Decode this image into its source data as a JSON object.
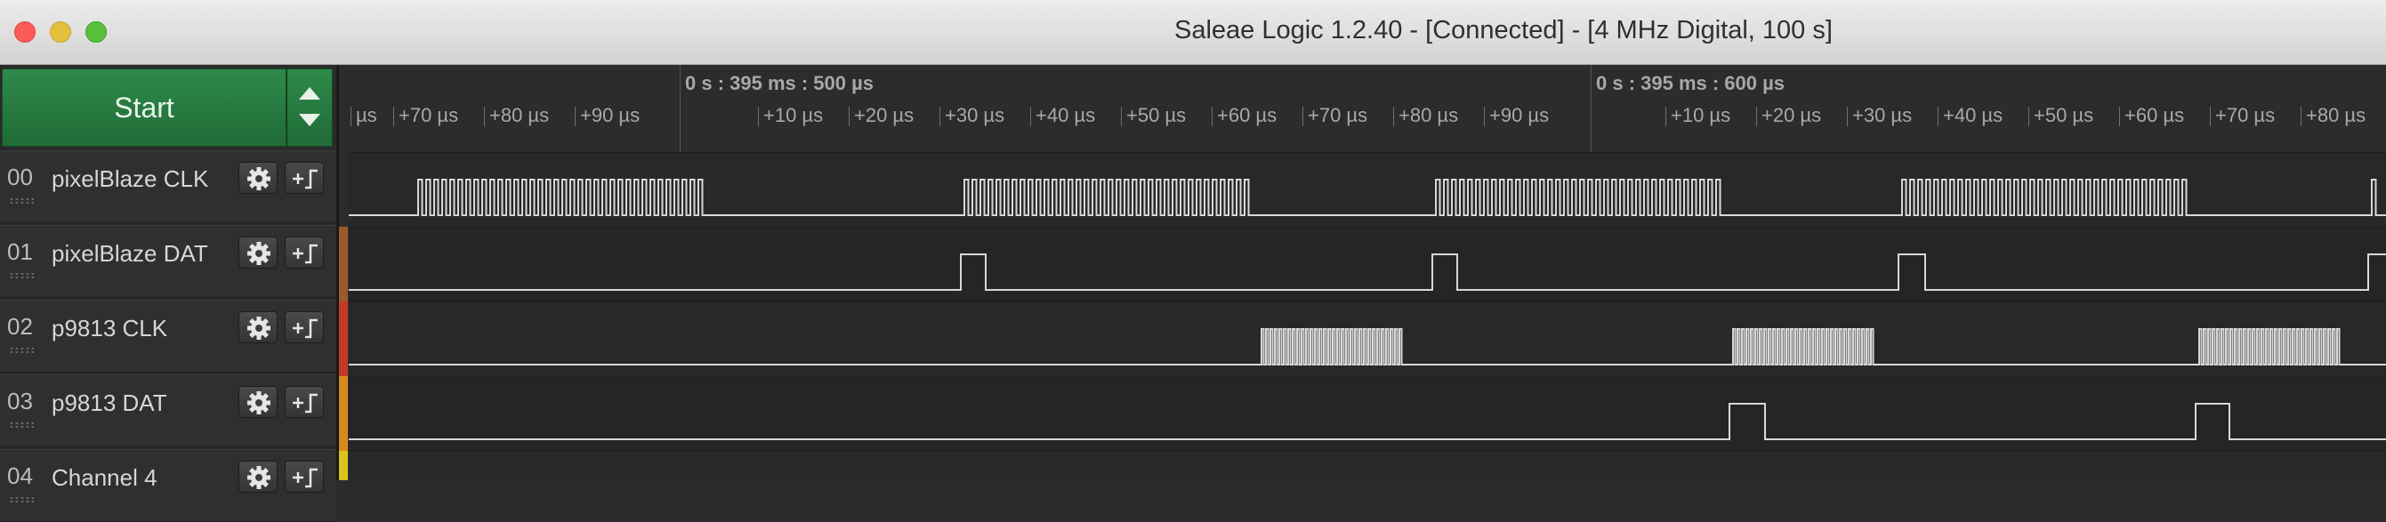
{
  "window": {
    "title": "Saleae Logic 1.2.40 - [Connected] - [4 MHz Digital, 100 s]"
  },
  "toolbar": {
    "start_label": "Start",
    "menu_icons": [
      "triangle-up-icon",
      "triangle-down-icon"
    ]
  },
  "timeline": {
    "major_labels": [
      "0 s : 395 ms : 500 µs",
      "0 s : 395 ms : 600 µs"
    ],
    "tick_labels": [
      "µs",
      "+70 µs",
      "+80 µs",
      "+90 µs",
      "+10 µs",
      "+20 µs",
      "+30 µs",
      "+40 µs",
      "+50 µs",
      "+60 µs",
      "+70 µs",
      "+80 µs",
      "+90 µs",
      "+10 µs",
      "+20 µs",
      "+30 µs",
      "+40 µs",
      "+50 µs",
      "+60 µs",
      "+70 µs",
      "+80 µs"
    ]
  },
  "channels": [
    {
      "num": "00",
      "name": "pixelBlaze CLK",
      "color": "#8a8a8a"
    },
    {
      "num": "01",
      "name": "pixelBlaze DAT",
      "color": "#9a5a2a"
    },
    {
      "num": "02",
      "name": "p9813 CLK",
      "color": "#c43a2a"
    },
    {
      "num": "03",
      "name": "p9813 DAT",
      "color": "#d98a1c"
    },
    {
      "num": "04",
      "name": "Channel 4",
      "color": "#d8c41c"
    }
  ],
  "colors": {
    "trace": "#d8d8d8",
    "accent_green": "#2a7d43"
  }
}
